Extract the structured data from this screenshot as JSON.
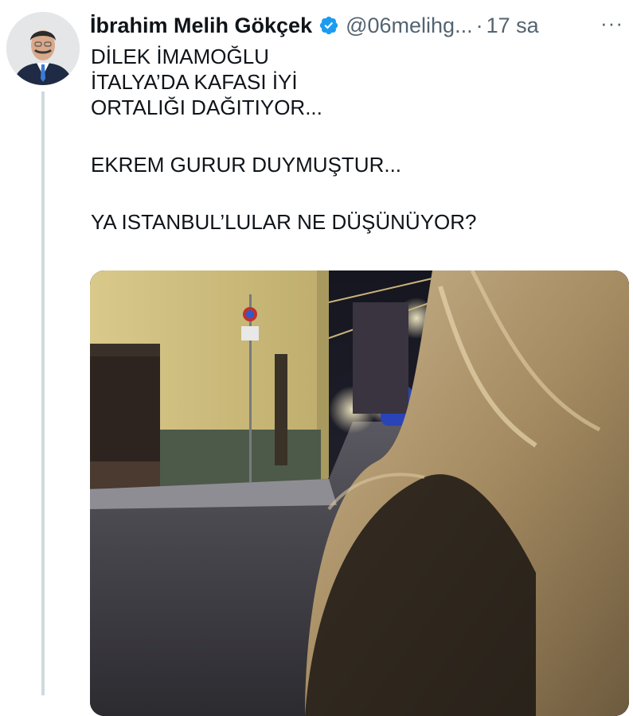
{
  "tweet": {
    "author_name": "İbrahim Melih Gökçek",
    "handle": "@06melihg...",
    "separator": "·",
    "time": "17 sa",
    "more_label": "···",
    "lines": [
      "DİLEK İMAMOĞLU",
      "İTALYA’DA KAFASI İYİ",
      "ORTALIĞI DAĞITIYOR...",
      "EKREM GURUR DUYMUŞTUR...",
      "YA ISTANBUL’LULAR NE DÜŞÜNÜYOR?"
    ]
  },
  "icons": {
    "verified": "verified-badge-icon",
    "more": "more-options-icon"
  },
  "colors": {
    "verified_blue": "#1d9bf0",
    "secondary_text": "#536471",
    "thread_line": "#cfd9de"
  }
}
